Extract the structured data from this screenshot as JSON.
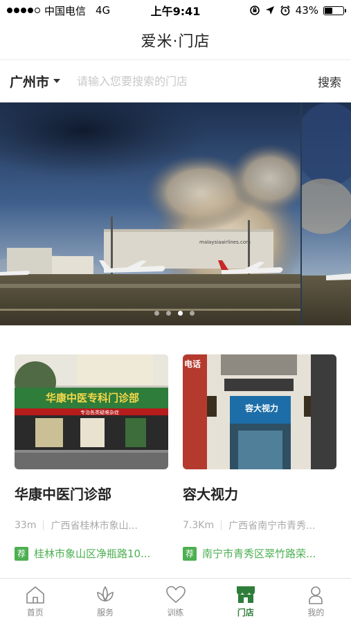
{
  "status_bar": {
    "carrier": "中国电信",
    "network": "4G",
    "time": "上午9:41",
    "battery": "43%",
    "battery_level": 0.43
  },
  "nav": {
    "title": "爱米·门店"
  },
  "search": {
    "city": "广州市",
    "placeholder": "请输入您要搜索的门店",
    "button_label": "搜索"
  },
  "banner": {
    "slide_count": 4,
    "active_index": 2,
    "building_sign": "malaysiaairlines.com"
  },
  "stores": [
    {
      "name": "华康中医门诊部",
      "distance": "33m",
      "address": "广西省桂林市象山...",
      "recommend_badge": "荐",
      "recommend_text": "桂林市象山区净瓶路10...",
      "sign_text": "华康中医专科门诊部",
      "sign_sub": "专治各类疑难杂症"
    },
    {
      "name": "容大视力",
      "distance": "7.3Km",
      "address": "广西省南宁市青秀...",
      "recommend_badge": "荐",
      "recommend_text": "南宁市青秀区翠竹路荣...",
      "sign_text": "容大视力",
      "sign_side": "电话"
    }
  ],
  "tabbar": {
    "items": [
      {
        "label": "首页",
        "icon": "home-icon",
        "active": false
      },
      {
        "label": "服务",
        "icon": "lotus-icon",
        "active": false
      },
      {
        "label": "训练",
        "icon": "heart-icon",
        "active": false
      },
      {
        "label": "门店",
        "icon": "store-icon",
        "active": true
      },
      {
        "label": "我的",
        "icon": "user-icon",
        "active": false
      }
    ],
    "active_color": "#2e7d3a",
    "inactive_color": "#888888"
  },
  "accent_green": "#4caf50"
}
